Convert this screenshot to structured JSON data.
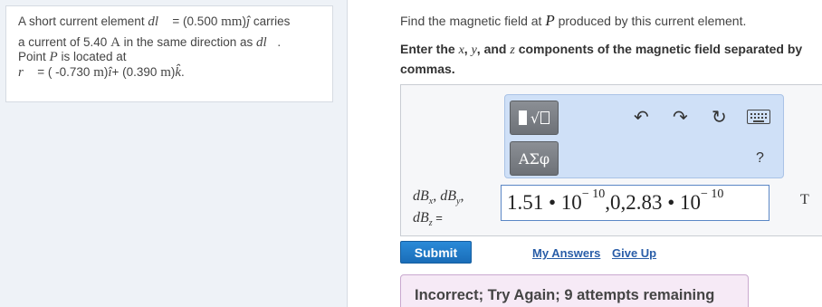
{
  "problem": {
    "line1_pre": "A short current element ",
    "dl_symbol": "dl⃗",
    "line1_eq": " = (0.500 ",
    "line1_unit": "mm",
    "line1_close": ")",
    "jhat": "ĵ",
    "line1_post": " carries",
    "line2_pre": "a current of 5.40  ",
    "line2_unit": "A",
    "line2_post": " in the same direction as ",
    "line2_dl": "dl⃗",
    "line2_end": ".",
    "line3_pre": "Point ",
    "line3_var": "P",
    "line3_post": " is located at",
    "line4_r": "r⃗",
    "line4_a": " = ( -0.730 ",
    "line4_m1": "m",
    "line4_b": ")",
    "line4_ihat": "î",
    "line4_c": "+ (0.390 ",
    "line4_m2": "m",
    "line4_d": ")",
    "line4_khat": "k̂",
    "line4_e": "."
  },
  "question": {
    "pre": "Find the magnetic field at ",
    "var": "P",
    "post": " produced by this current element."
  },
  "instruction": {
    "t1": "Enter the ",
    "x": "x",
    "t2": ", ",
    "y": "y",
    "t3": ", and ",
    "z": "z",
    "t4": " components of the magnetic field separated by commas."
  },
  "toolbar": {
    "greek_label": "ΑΣφ",
    "undo_icon": "↶",
    "redo_icon": "↷",
    "reset_icon": "↻",
    "help_label": "?"
  },
  "answer": {
    "label_dB": "dB",
    "sub_x": "x",
    "sub_y": "y",
    "sub_z": "z",
    "sep": ", ",
    "eq": " =",
    "value_a": "1.51 • 10",
    "exp_a": "− 10",
    "value_b": ",0,2.83 • 10",
    "exp_b": "− 10",
    "units": "T"
  },
  "actions": {
    "submit": "Submit",
    "my_answers": "My Answers",
    "give_up": "Give Up"
  },
  "feedback": {
    "message": "Incorrect; Try Again; 9 attempts remaining"
  },
  "colors": {
    "submit_bg": "#1a6db8",
    "toolbar_bg": "#cfe0f7",
    "feedback_bg": "#f6eaf6",
    "link": "#2a5ea8"
  }
}
